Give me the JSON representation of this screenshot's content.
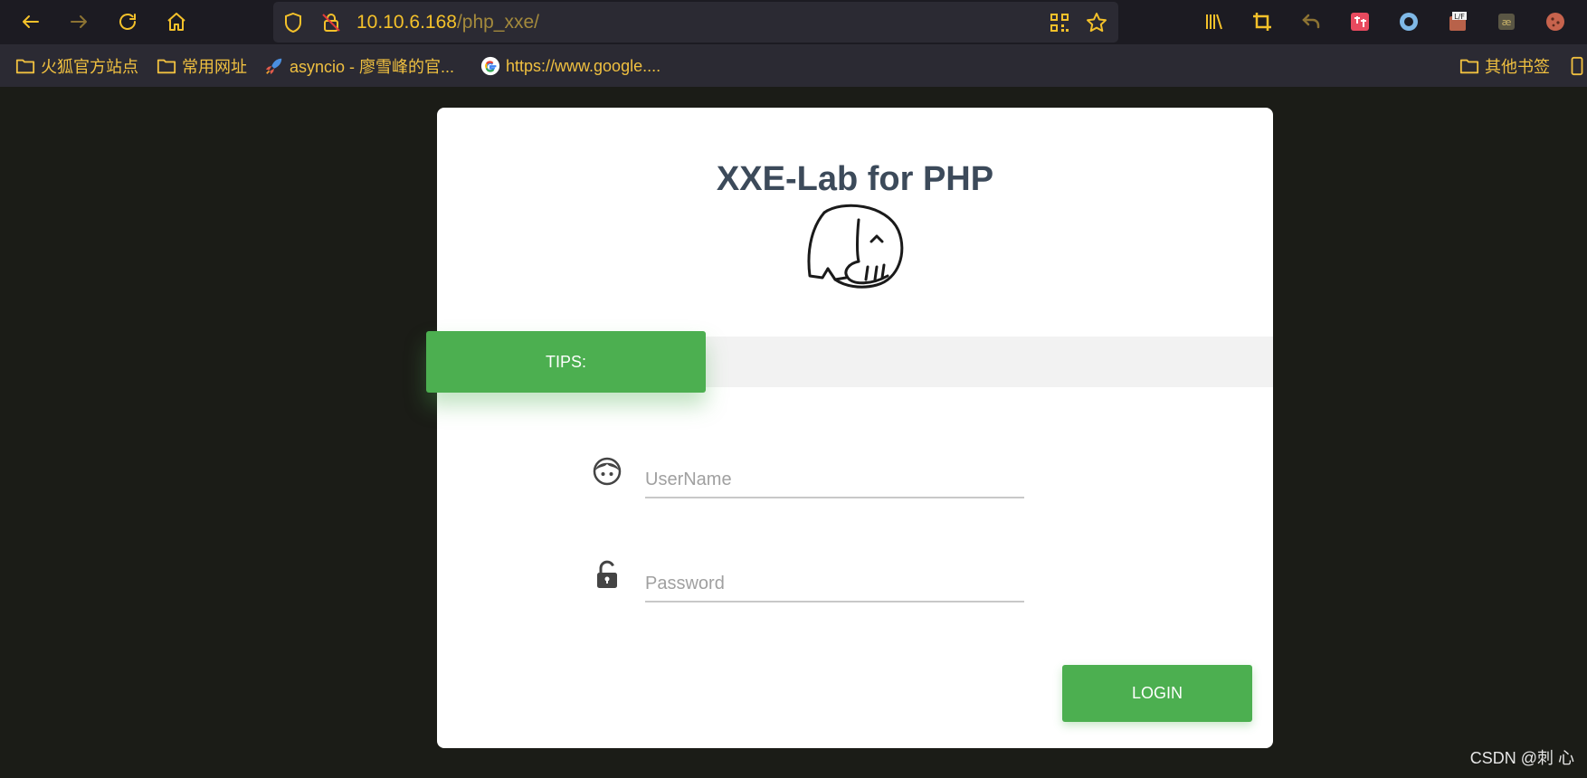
{
  "browser": {
    "url_host": "10.10.6.168",
    "url_path": "/php_xxe/",
    "bookmarks": [
      {
        "label": "火狐官方站点",
        "icon": "folder-icon"
      },
      {
        "label": "常用网址",
        "icon": "folder-icon"
      },
      {
        "label": "asyncio - 廖雪峰的官...",
        "icon": "rocket-icon"
      },
      {
        "label": "https://www.google....",
        "icon": "google-icon"
      }
    ],
    "other_bookmarks": "其他书签",
    "accent_color": "#f4c12a"
  },
  "page": {
    "title": "XXE-Lab for PHP",
    "tips_label": "TIPS:",
    "username_placeholder": "UserName",
    "password_placeholder": "Password",
    "login_label": "LOGIN",
    "accent_color": "#4caf50"
  },
  "watermark": "CSDN @刺  心"
}
